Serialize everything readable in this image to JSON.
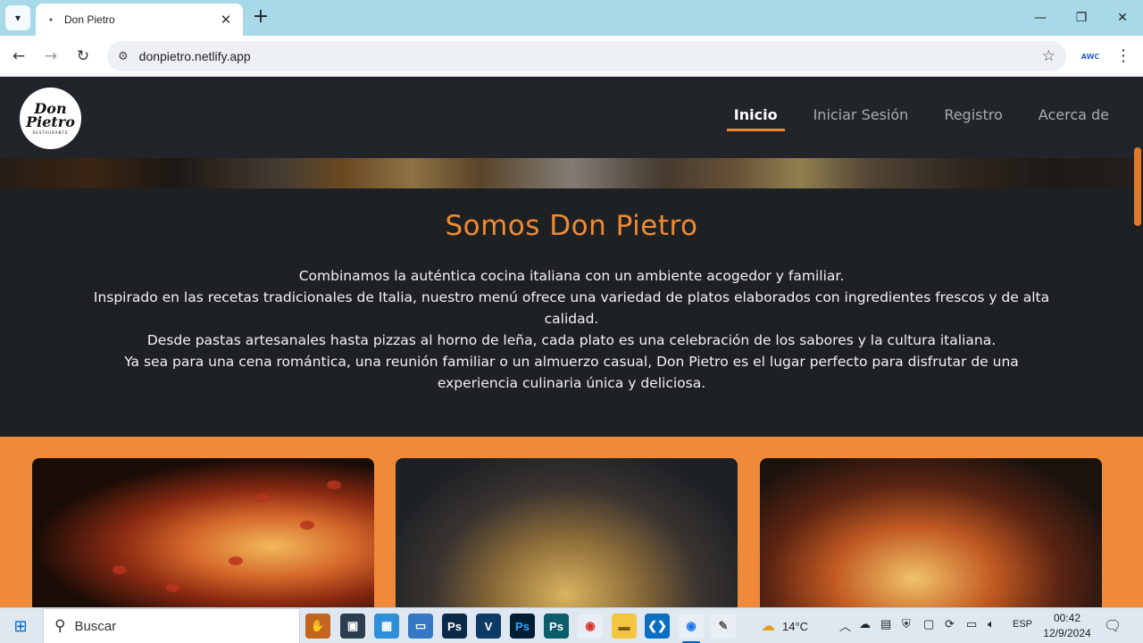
{
  "browser": {
    "tab_title": "Don Pietro",
    "tab_favicon": "Don Pietro",
    "url": "donpietro.netlify.app",
    "extension_label": "AWC"
  },
  "site": {
    "logo": {
      "line1": "Don",
      "line2": "Pietro",
      "line3": "RESTAURANTE"
    },
    "nav": [
      {
        "label": "Inicio",
        "active": true
      },
      {
        "label": "Iniciar Sesión",
        "active": false
      },
      {
        "label": "Registro",
        "active": false
      },
      {
        "label": "Acerca de",
        "active": false
      }
    ],
    "about": {
      "title": "Somos Don Pietro",
      "paragraph": [
        "Combinamos la auténtica cocina italiana con un ambiente acogedor y familiar.",
        "Inspirado en las recetas tradicionales de Italia, nuestro menú ofrece una variedad de platos elaborados con ingredientes frescos y de alta calidad.",
        "Desde pastas artesanales hasta pizzas al horno de leña, cada plato es una celebración de los sabores y la cultura italiana.",
        "Ya sea para una cena romántica, una reunión familiar o un almuerzo casual, Don Pietro es el lugar perfecto para disfrutar de una experiencia culinaria única y deliciosa."
      ]
    },
    "cards": [
      {
        "image": "pizza-image"
      },
      {
        "image": "rice-pan-image"
      },
      {
        "image": "lasagna-image"
      }
    ],
    "colors": {
      "accent": "#f08a32",
      "header_bg": "#212529",
      "body_bg": "#1e2124",
      "section_bg": "#ee8a3a"
    }
  },
  "taskbar": {
    "search_placeholder": "Buscar",
    "apps": [
      {
        "name": "baseball-glove-app-icon",
        "label": ""
      },
      {
        "name": "media-app-icon",
        "label": ""
      },
      {
        "name": "calculator-app-icon",
        "label": ""
      },
      {
        "name": "computer-app-icon",
        "label": ""
      },
      {
        "name": "photoshop-app-icon",
        "label": "Ps"
      },
      {
        "name": "visio-app-icon",
        "label": "V"
      },
      {
        "name": "photoshop-alt-app-icon",
        "label": "Ps"
      },
      {
        "name": "photoshop-teal-app-icon",
        "label": "Ps"
      },
      {
        "name": "chrome-app-icon",
        "label": ""
      },
      {
        "name": "file-explorer-icon",
        "label": ""
      },
      {
        "name": "vscode-app-icon",
        "label": ""
      },
      {
        "name": "chrome-active-app-icon",
        "label": ""
      },
      {
        "name": "paint-app-icon",
        "label": ""
      }
    ],
    "weather": "14°C",
    "language": "ESP",
    "time": "00:42",
    "date": "12/9/2024"
  }
}
